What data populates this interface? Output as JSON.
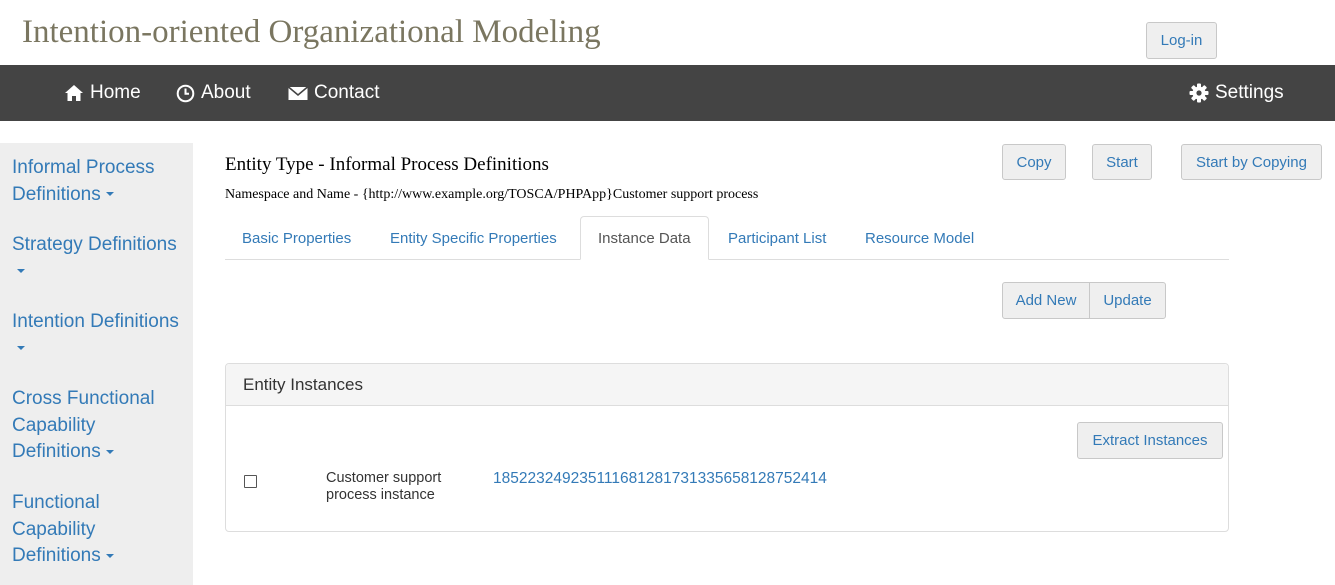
{
  "header": {
    "app_title": "Intention-oriented Organizational Modeling",
    "login_label": "Log-in"
  },
  "navbar": {
    "home": "Home",
    "about": "About",
    "contact": "Contact",
    "settings": "Settings",
    "icons": [
      "home-icon",
      "clock-icon",
      "envelope-icon",
      "gear-icon"
    ]
  },
  "sidebar": {
    "items": [
      {
        "label": "Informal Process Definitions"
      },
      {
        "label": "Strategy Definitions"
      },
      {
        "label": "Intention Definitions"
      },
      {
        "label": "Cross Functional Capability Definitions"
      },
      {
        "label": "Functional Capability Definitions"
      }
    ]
  },
  "entity": {
    "title": "Entity Type - Informal Process Definitions",
    "namespace_line": "Namespace and Name - {http://www.example.org/TOSCA/PHPApp}Customer support process"
  },
  "actions": {
    "copy": "Copy",
    "start": "Start",
    "start_by_copying": "Start by Copying"
  },
  "tabs": [
    {
      "label": "Basic Properties",
      "active": false
    },
    {
      "label": "Entity Specific Properties",
      "active": false
    },
    {
      "label": "Instance Data",
      "active": true
    },
    {
      "label": "Participant List",
      "active": false
    },
    {
      "label": "Resource Model",
      "active": false
    }
  ],
  "instance_actions": {
    "add_new": "Add New",
    "update": "Update"
  },
  "panel": {
    "heading": "Entity Instances",
    "extract_label": "Extract Instances",
    "rows": [
      {
        "checked": false,
        "name": "Customer support process instance",
        "id": "1852232492351116812817313356581287524​14"
      }
    ]
  },
  "colors": {
    "link": "#337ab7",
    "navbar_bg": "#444444",
    "sidebar_bg": "#eeeeee",
    "title": "#7a7660"
  }
}
